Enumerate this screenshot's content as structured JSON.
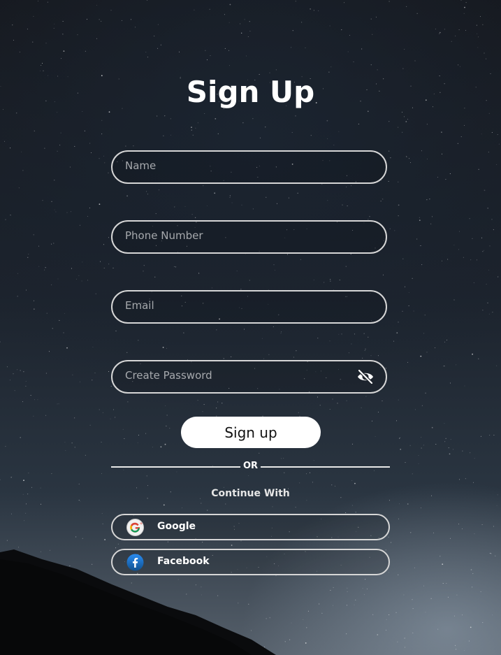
{
  "page": {
    "title": "Sign Up"
  },
  "form": {
    "name_placeholder": "Name",
    "phone_placeholder": "Phone Number",
    "email_placeholder": "Email",
    "password_placeholder": "Create Password",
    "password_toggle_icon": "eye-slash-icon",
    "submit_label": "Sign up"
  },
  "divider": {
    "label": "OR"
  },
  "social": {
    "heading": "Continue With",
    "providers": [
      {
        "label": "Google",
        "icon": "google-icon"
      },
      {
        "label": "Facebook",
        "icon": "facebook-icon"
      }
    ]
  },
  "colors": {
    "text": "#ffffff",
    "border": "#d6d6d6",
    "button_bg": "#ffffff",
    "button_text": "#111111",
    "facebook_blue": "#1877f2"
  }
}
